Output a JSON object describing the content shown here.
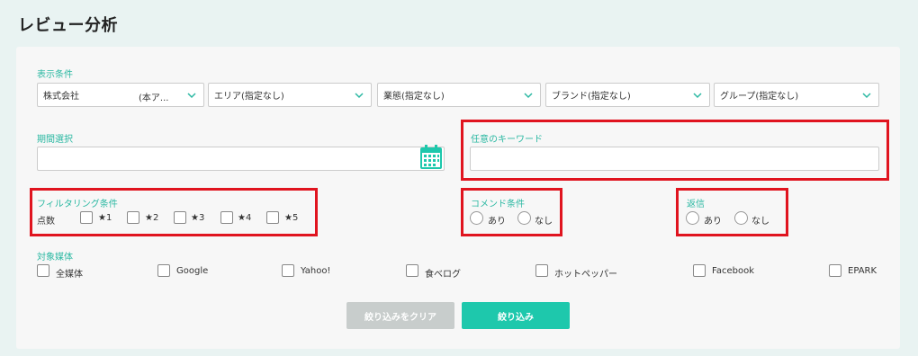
{
  "title": "レビュー分析",
  "display": {
    "label": "表示条件",
    "selects": [
      {
        "value": "株式会社",
        "sub": "(本ア..."
      },
      {
        "value": "エリア(指定なし)",
        "sub": ""
      },
      {
        "value": "業態(指定なし)",
        "sub": ""
      },
      {
        "value": "ブランド(指定なし)",
        "sub": ""
      },
      {
        "value": "グループ(指定なし)",
        "sub": ""
      }
    ]
  },
  "period": {
    "label": "期間選択",
    "value": ""
  },
  "keyword": {
    "label": "任意のキーワード",
    "value": ""
  },
  "filtering": {
    "label": "フィルタリング条件",
    "score_label": "点数",
    "stars": [
      "★1",
      "★2",
      "★3",
      "★4",
      "★5"
    ]
  },
  "comment": {
    "label": "コメンド条件",
    "options": [
      "あり",
      "なし"
    ]
  },
  "reply": {
    "label": "返信",
    "options": [
      "あり",
      "なし"
    ]
  },
  "media": {
    "label": "対象媒体",
    "items": [
      "全媒体",
      "Google",
      "Yahoo!",
      "食べログ",
      "ホットペッパー",
      "Facebook",
      "EPARK"
    ]
  },
  "buttons": {
    "clear": "絞り込みをクリア",
    "filter": "絞り込み"
  },
  "colors": {
    "accent": "#1ec8ac",
    "label": "#2bb8a2",
    "highlight": "#e0141f",
    "disabled": "#c8cdcc"
  }
}
